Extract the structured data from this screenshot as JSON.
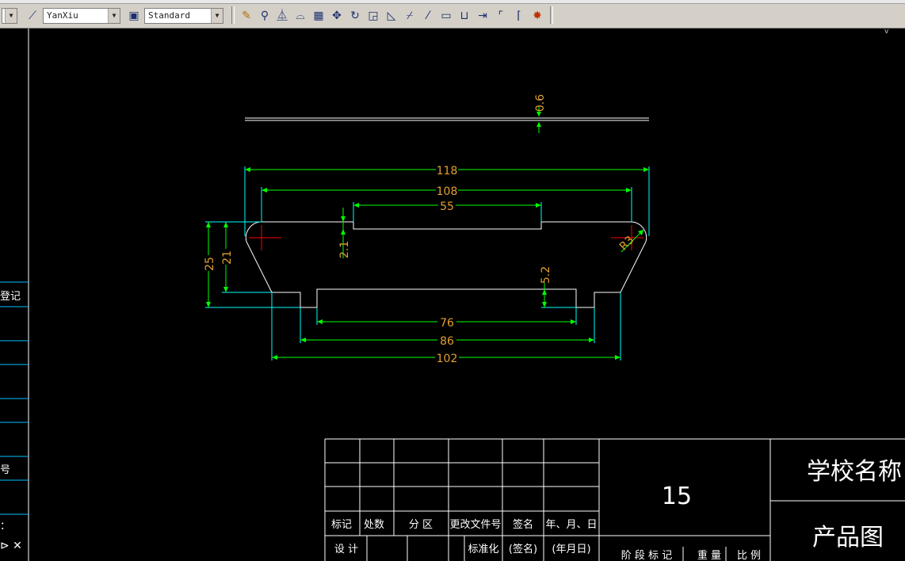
{
  "toolbar": {
    "linetype_value": "YanXiu",
    "dimstyle_value": "Standard",
    "icons": [
      "pencil-icon",
      "measure-icon",
      "mirror-icon",
      "offset-icon",
      "array-icon",
      "move-icon",
      "rotate-icon",
      "scale-icon",
      "stretch-icon",
      "trim-icon",
      "extend-icon",
      "break-icon",
      "join-icon",
      "chamfer-icon",
      "fillet-icon",
      "explode-icon"
    ]
  },
  "drawing": {
    "dimensions": {
      "thickness": "0.6",
      "overall_top": "118",
      "inner_top": "108",
      "slot_top": "55",
      "left_height_outer": "25",
      "left_height_inner": "21",
      "slot_depth": "2.1",
      "bottom_step": "5.2",
      "bottom_inner": "76",
      "bottom_mid": "86",
      "bottom_outer": "102",
      "radius": "R3"
    }
  },
  "left_panel": {
    "label_1": "登记",
    "label_2": "号",
    "label_3": "："
  },
  "title_block": {
    "scale_number": "15",
    "school_name": "学校名称",
    "drawing_name": "产品图",
    "headers": [
      "标记",
      "处数",
      "分  区",
      "更改文件号",
      "签名",
      "年、月、日"
    ],
    "design_row": [
      "设  计",
      "标准化",
      "(签名)",
      "(年月日)"
    ],
    "stage_label": "阶  段  标  记",
    "weight_label": "重  量",
    "ratio_label": "比  例"
  },
  "colors": {
    "background": "#000000",
    "geometry": "#ffffff",
    "dimension_line": "#00ff00",
    "dimension_text": "#e0a030",
    "extension_line": "#00ffff",
    "center_mark": "#ff0000"
  }
}
